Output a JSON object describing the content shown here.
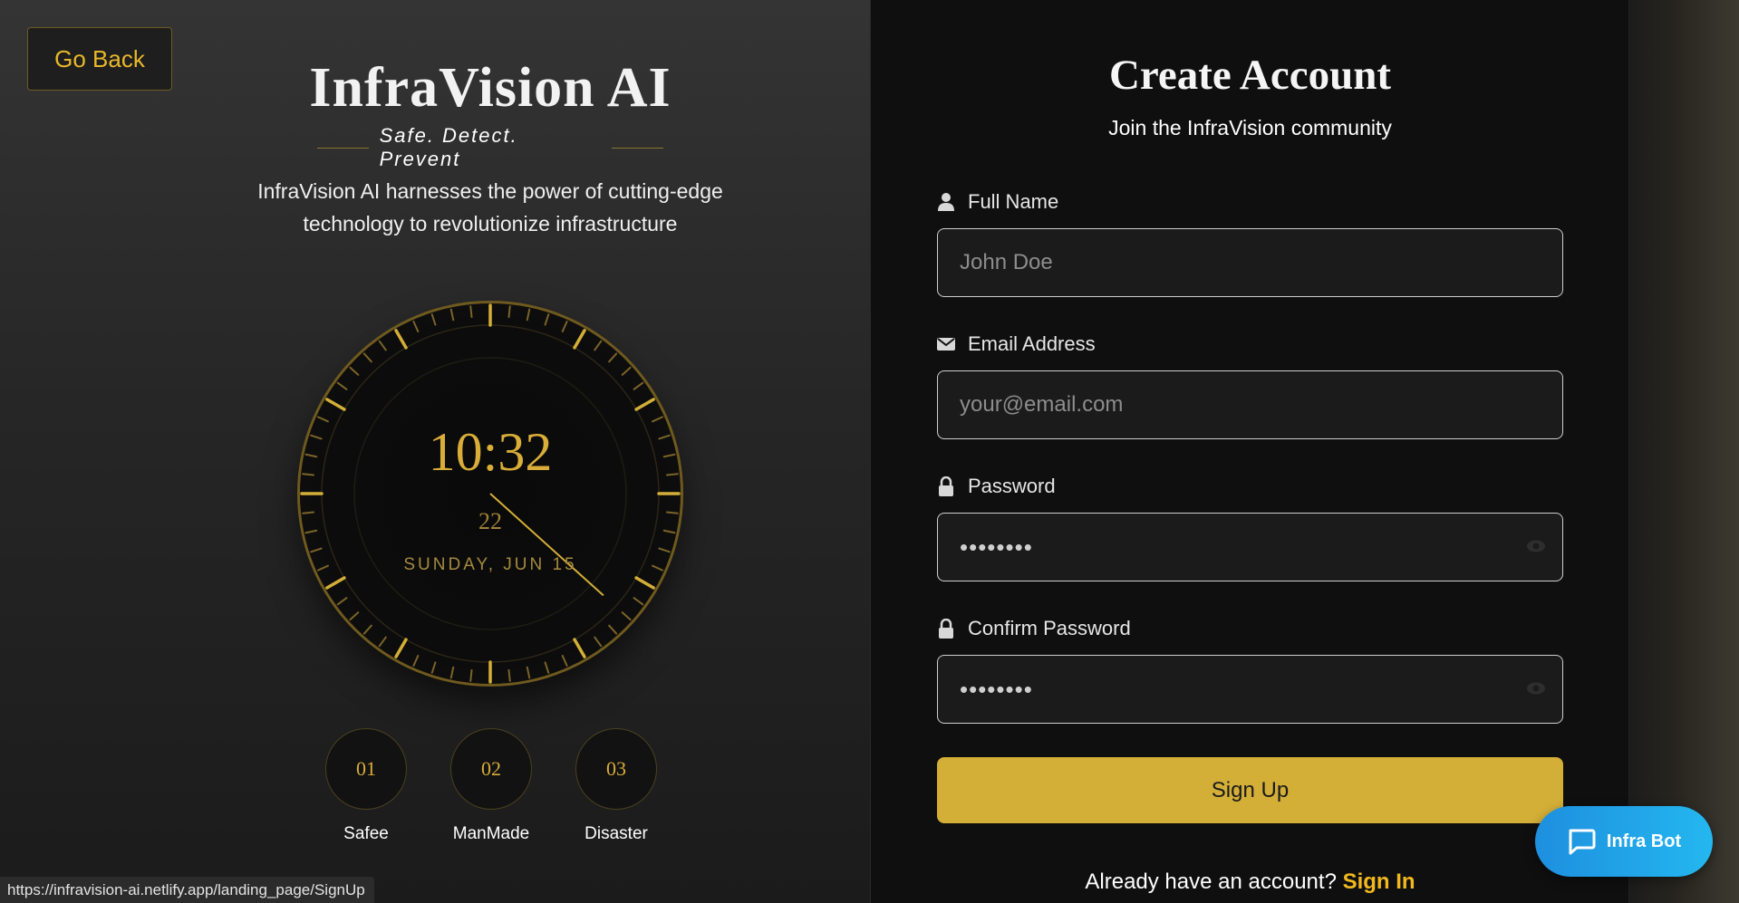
{
  "nav": {
    "go_back_label": "Go Back"
  },
  "brand": {
    "title": "InfraVision AI",
    "tagline": "Safe. Detect. Prevent",
    "intro": "InfraVision AI harnesses the power of cutting-edge technology to revolutionize infrastructure"
  },
  "clock": {
    "time": "10:32",
    "seconds": "22",
    "date": "SUNDAY, JUN 15",
    "accent": "#d4af37"
  },
  "steps": [
    {
      "number": "01",
      "label": "Safee"
    },
    {
      "number": "02",
      "label": "ManMade"
    },
    {
      "number": "03",
      "label": "Disaster"
    }
  ],
  "form": {
    "title": "Create Account",
    "subtitle": "Join the InfraVision community",
    "full_name": {
      "label": "Full Name",
      "placeholder": "John Doe",
      "icon": "user-icon"
    },
    "email": {
      "label": "Email Address",
      "placeholder": "your@email.com",
      "icon": "envelope-icon"
    },
    "password": {
      "label": "Password",
      "value": "••••••••",
      "icon": "lock-icon"
    },
    "confirm_password": {
      "label": "Confirm Password",
      "value": "••••••••",
      "icon": "lock-icon"
    },
    "submit_label": "Sign Up",
    "signin_prompt": "Already have an account?",
    "signin_link": "Sign In"
  },
  "chatbot": {
    "label": "Infra Bot",
    "icon": "chat-icon",
    "color": "#24b7f0"
  },
  "status_bar": {
    "url": "https://infravision-ai.netlify.app/landing_page/SignUp"
  }
}
